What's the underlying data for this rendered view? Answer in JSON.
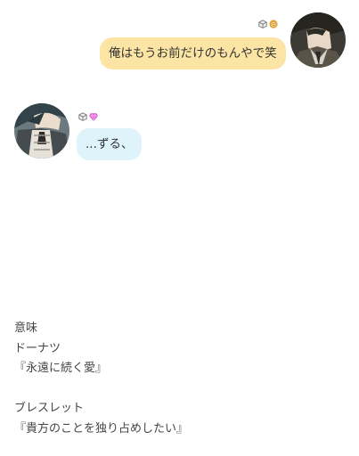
{
  "chat": {
    "messages": [
      {
        "side": "right",
        "text": "俺はもうお前だけのもんやで笑",
        "avatar_icon": "character-avatar-icon",
        "badges": [
          "cube-icon",
          "lion-icon"
        ],
        "bubble_color": "#fce4a4"
      },
      {
        "side": "left",
        "text": "...ずる、",
        "avatar_icon": "character-avatar-icon",
        "badges": [
          "cube-icon",
          "gem-icon"
        ],
        "bubble_color": "#dff3fb"
      }
    ]
  },
  "note": {
    "lines": [
      "意味",
      "ドーナツ",
      "『永遠に続く愛』",
      "",
      "ブレスレット",
      "『貴方のことを独り占めしたい』"
    ]
  },
  "colors": {
    "background": "#ffffff",
    "right_bubble": "#fce4a4",
    "left_bubble": "#dff3fb",
    "gem": "#e86ce0",
    "lion": "#e0a040"
  }
}
